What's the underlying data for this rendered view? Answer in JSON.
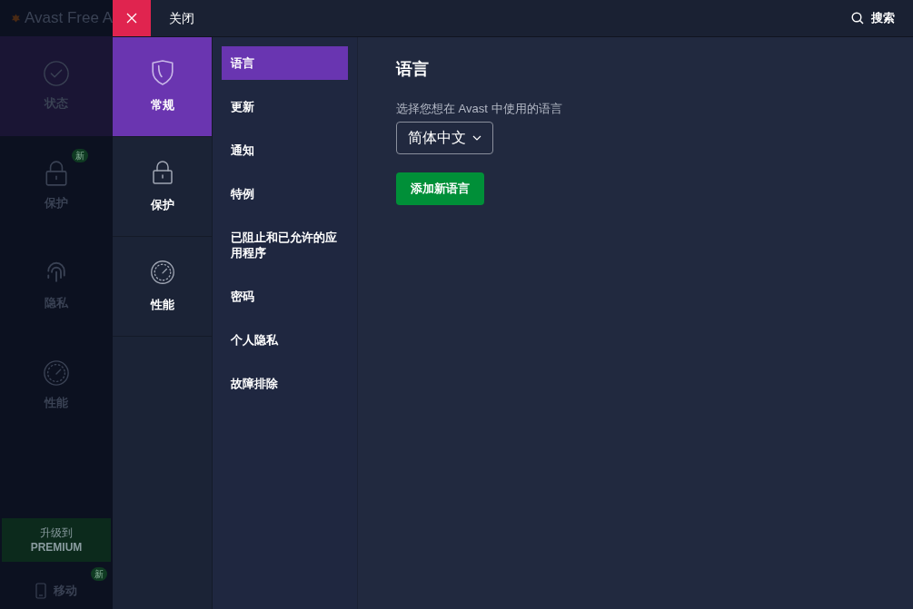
{
  "background_app": {
    "title": "Avast Free A",
    "nav": [
      {
        "label": "状态",
        "selected": true
      },
      {
        "label": "保护",
        "selected": false,
        "badge": "新"
      },
      {
        "label": "隐私",
        "selected": false
      },
      {
        "label": "性能",
        "selected": false
      }
    ],
    "upgrade": {
      "line1": "升级到",
      "line2": "PREMIUM"
    },
    "mobile": {
      "label": "移动",
      "badge": "新"
    }
  },
  "settings": {
    "close_label": "关闭",
    "search_label": "搜索",
    "categories": [
      {
        "label": "常规",
        "selected": true
      },
      {
        "label": "保护",
        "selected": false
      },
      {
        "label": "性能",
        "selected": false
      }
    ],
    "subnav": [
      {
        "label": "语言",
        "selected": true
      },
      {
        "label": "更新",
        "selected": false
      },
      {
        "label": "通知",
        "selected": false
      },
      {
        "label": "特例",
        "selected": false
      },
      {
        "label": "已阻止和已允许的应用程序",
        "selected": false
      },
      {
        "label": "密码",
        "selected": false
      },
      {
        "label": "个人隐私",
        "selected": false
      },
      {
        "label": "故障排除",
        "selected": false
      }
    ],
    "content": {
      "title": "语言",
      "field_label": "选择您想在 Avast 中使用的语言",
      "language": "简体中文",
      "add_button": "添加新语言"
    }
  }
}
